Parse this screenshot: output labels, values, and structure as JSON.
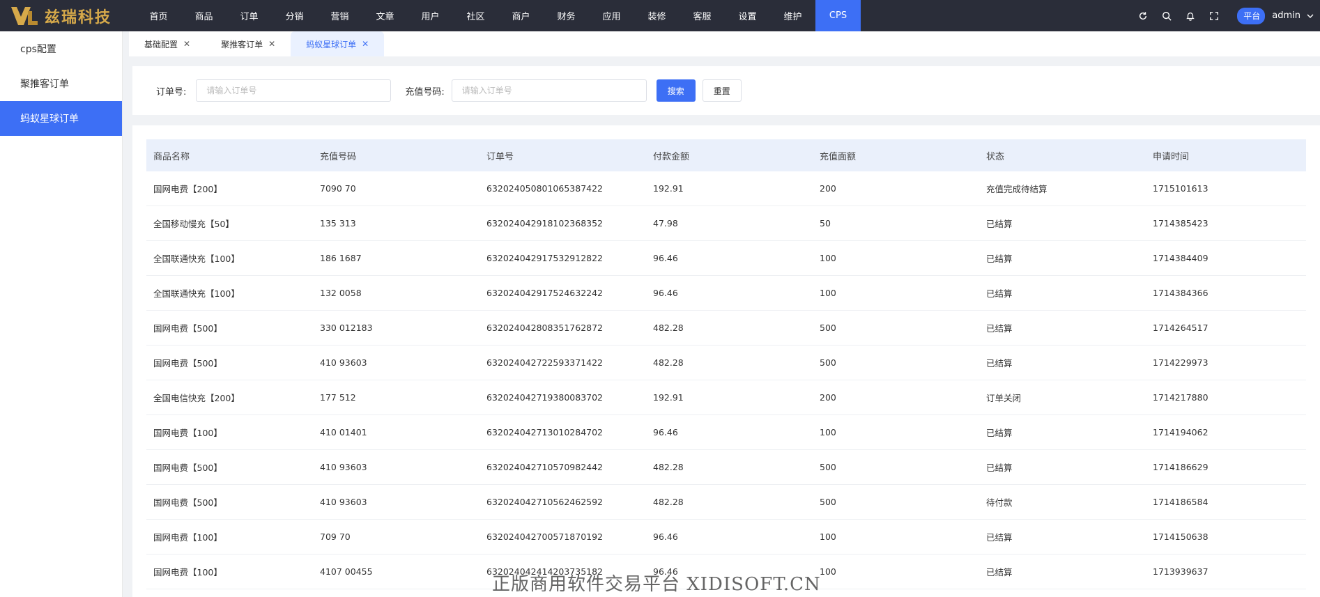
{
  "brand": {
    "logo_text": "兹瑞科技",
    "accent": "#3d6ff5"
  },
  "nav": {
    "items": [
      "首页",
      "商品",
      "订单",
      "分销",
      "营销",
      "文章",
      "用户",
      "社区",
      "商户",
      "财务",
      "应用",
      "装修",
      "客服",
      "设置",
      "维护",
      "CPS"
    ],
    "active_index": 15
  },
  "header": {
    "icons": [
      "refresh-icon",
      "search-icon",
      "bell-icon",
      "fullscreen-icon"
    ],
    "platform_badge": "平台",
    "username": "admin"
  },
  "sidebar": {
    "items": [
      {
        "label": "cps配置"
      },
      {
        "label": "聚推客订单"
      },
      {
        "label": "蚂蚁星球订单"
      }
    ],
    "active_index": 2
  },
  "tabs": [
    {
      "label": "基础配置",
      "close": "✕"
    },
    {
      "label": "聚推客订单",
      "close": "✕"
    },
    {
      "label": "蚂蚁星球订单",
      "close": "✕"
    }
  ],
  "search": {
    "order_label": "订单号:",
    "order_placeholder": "请输入订单号",
    "phone_label": "充值号码:",
    "phone_placeholder": "请输入订单号",
    "search_button": "搜索",
    "reset_button": "重置"
  },
  "table": {
    "columns": [
      "商品名称",
      "充值号码",
      "订单号",
      "付款金额",
      "充值面额",
      "状态",
      "申请时间"
    ],
    "rows": [
      [
        "国网电费【200】",
        "7090   70",
        "632024050801065387422",
        "192.91",
        "200",
        "充值完成待结算",
        "1715101613"
      ],
      [
        "全国移动慢充【50】",
        "135   313",
        "632024042918102368352",
        "47.98",
        "50",
        "已结算",
        "1714385423"
      ],
      [
        "全国联通快充【100】",
        "186   1687",
        "632024042917532912822",
        "96.46",
        "100",
        "已结算",
        "1714384409"
      ],
      [
        "全国联通快充【100】",
        "132   0058",
        "632024042917524632242",
        "96.46",
        "100",
        "已结算",
        "1714384366"
      ],
      [
        "国网电费【500】",
        "330   012183",
        "632024042808351762872",
        "482.28",
        "500",
        "已结算",
        "1714264517"
      ],
      [
        "国网电费【500】",
        "410   93603",
        "632024042722593371422",
        "482.28",
        "500",
        "已结算",
        "1714229973"
      ],
      [
        "全国电信快充【200】",
        "177   512",
        "632024042719380083702",
        "192.91",
        "200",
        "订单关闭",
        "1714217880"
      ],
      [
        "国网电费【100】",
        "410   01401",
        "632024042713010284702",
        "96.46",
        "100",
        "已结算",
        "1714194062"
      ],
      [
        "国网电费【500】",
        "410   93603",
        "632024042710570982442",
        "482.28",
        "500",
        "已结算",
        "1714186629"
      ],
      [
        "国网电费【500】",
        "410   93603",
        "632024042710562462592",
        "482.28",
        "500",
        "待付款",
        "1714186584"
      ],
      [
        "国网电费【100】",
        "709   70",
        "632024042700571870192",
        "96.46",
        "100",
        "已结算",
        "1714150638"
      ],
      [
        "国网电费【100】",
        "4107   00455",
        "632024042414203735182",
        "96.46",
        "100",
        "已结算",
        "1713939637"
      ]
    ]
  },
  "watermark": "正版商用软件交易平台 XIDISOFT.CN"
}
